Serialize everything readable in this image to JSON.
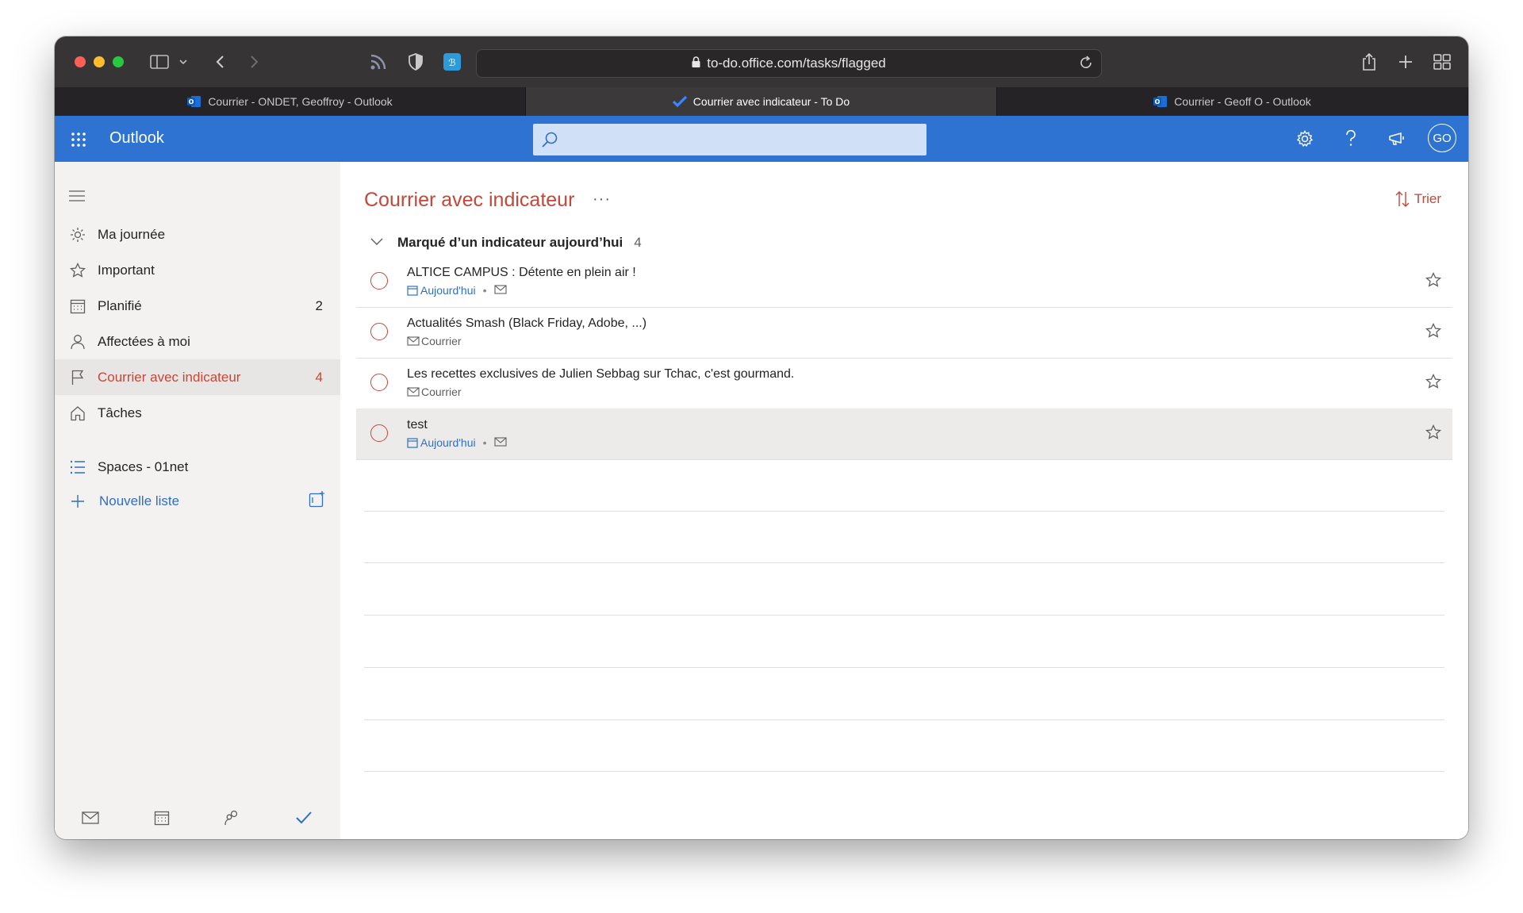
{
  "browser": {
    "url": "to-do.office.com/tasks/flagged",
    "tabs": [
      {
        "label": "Courrier - ONDET, Geoffroy - Outlook",
        "icon": "outlook-icon",
        "active": false
      },
      {
        "label": "Courrier avec indicateur - To Do",
        "icon": "todo-check-icon",
        "active": true
      },
      {
        "label": "Courrier - Geoff O - Outlook",
        "icon": "outlook-icon",
        "active": false
      }
    ]
  },
  "header": {
    "app_name": "Outlook",
    "search_placeholder": "",
    "avatar_initials": "GO",
    "accent_color": "#2f73d2"
  },
  "sidebar": {
    "items": [
      {
        "label": "Ma journée",
        "icon": "sun-icon",
        "count": ""
      },
      {
        "label": "Important",
        "icon": "star-icon",
        "count": ""
      },
      {
        "label": "Planifié",
        "icon": "calendar-icon",
        "count": "2"
      },
      {
        "label": "Affectées à moi",
        "icon": "person-icon",
        "count": ""
      },
      {
        "label": "Courrier avec indicateur",
        "icon": "flag-icon",
        "count": "4",
        "active": true
      },
      {
        "label": "Tâches",
        "icon": "home-icon",
        "count": ""
      }
    ],
    "lists": [
      {
        "label": "Spaces - 01net",
        "icon": "list-icon"
      }
    ],
    "new_list_label": "Nouvelle liste"
  },
  "main": {
    "title": "Courrier avec indicateur",
    "more_label": "···",
    "sort_label": "Trier",
    "group": {
      "label": "Marqué d’un indicateur aujourd’hui",
      "count": "4"
    },
    "tasks": [
      {
        "title": "ALTICE CAMPUS : Détente en plein air !",
        "date": "Aujourd'hui",
        "source": ""
      },
      {
        "title": "Actualités Smash (Black Friday, Adobe, ...)",
        "date": "",
        "source": "Courrier"
      },
      {
        "title": "Les recettes exclusives de Julien Sebbag sur Tchac, c'est gourmand.",
        "date": "",
        "source": "Courrier"
      },
      {
        "title": "test",
        "date": "Aujourd'hui",
        "source": ""
      }
    ],
    "accent_color": "#c4473a"
  }
}
